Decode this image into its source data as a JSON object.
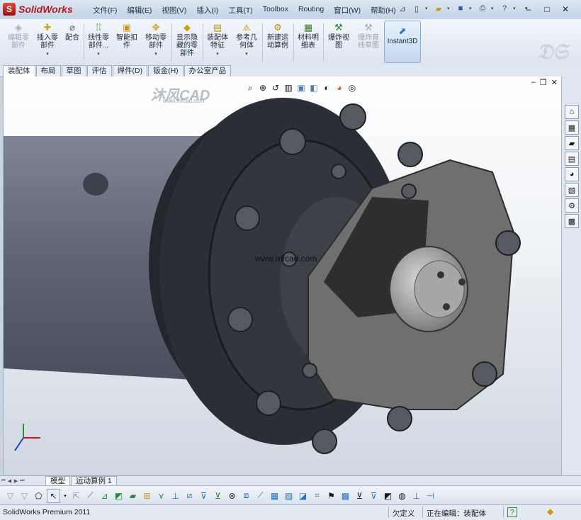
{
  "app": {
    "name": "SolidWorks"
  },
  "menu": [
    "文件(F)",
    "编辑(E)",
    "视图(V)",
    "插入(I)",
    "工具(T)",
    "Toolbox",
    "Routing",
    "窗口(W)",
    "帮助(H)"
  ],
  "quick_access": [
    "pin-icon",
    "new-doc-icon",
    "open-icon",
    "save-icon",
    "print-icon",
    "help-icon",
    "options-icon"
  ],
  "window_buttons": [
    "minimize-icon",
    "restore-icon",
    "close-icon"
  ],
  "commands": [
    {
      "label": "编辑零\n部件",
      "disabled": true
    },
    {
      "label": "插入零\n部件",
      "disabled": false,
      "dropdown": true
    },
    {
      "label": "配合",
      "disabled": false
    },
    {
      "label": "线性零\n部件...",
      "disabled": false,
      "dropdown": true
    },
    {
      "label": "智能扣\n件",
      "disabled": false
    },
    {
      "label": "移动零\n部件",
      "disabled": false,
      "dropdown": true
    },
    {
      "label": "显示隐\n藏的零\n部件",
      "disabled": false
    },
    {
      "label": "装配体\n特征",
      "disabled": false,
      "dropdown": true
    },
    {
      "label": "参考几\n何体",
      "disabled": false,
      "dropdown": true
    },
    {
      "label": "新建运\n动算例",
      "disabled": false
    },
    {
      "label": "材料明\n细表",
      "disabled": false
    },
    {
      "label": "爆炸视\n图",
      "disabled": false
    },
    {
      "label": "爆炸直\n线草图",
      "disabled": true
    },
    {
      "label": "Instant3D",
      "disabled": false
    }
  ],
  "tabs": [
    "装配体",
    "布局",
    "草图",
    "评估",
    "焊件(D)",
    "钣金(H)",
    "办公室产品"
  ],
  "active_tab": "装配体",
  "viewport": {
    "watermark": "沐风CAD",
    "watermark_sub": "www.mfcad.com",
    "center_text": "www.mfcad.com"
  },
  "bottom_tabs": [
    "模型",
    "运动算例 1"
  ],
  "status": {
    "product": "SolidWorks Premium 2011",
    "definition": "欠定义",
    "editing": "正在编辑：装配体",
    "help": "?"
  },
  "colors": {
    "accent": "#b0191e",
    "tab_active": "#ffffff",
    "viewport_top": "#ffffff",
    "viewport_bottom": "#cfd7e1"
  }
}
